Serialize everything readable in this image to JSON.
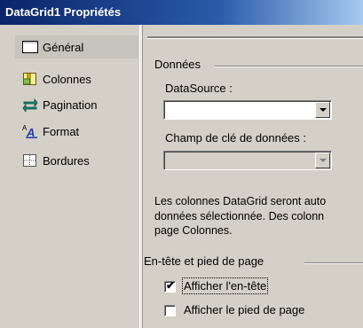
{
  "window": {
    "title": "DataGrid1 Propriétés"
  },
  "nav": {
    "items": [
      {
        "label": "Général",
        "icon": "general-page-icon",
        "selected": true
      },
      {
        "label": "Colonnes",
        "icon": "columns-icon"
      },
      {
        "label": "Pagination",
        "icon": "pagination-icon"
      },
      {
        "label": "Format",
        "icon": "format-icon"
      },
      {
        "label": "Bordures",
        "icon": "borders-icon"
      }
    ]
  },
  "data_group": {
    "title": "Données",
    "datasource_label": "DataSource :",
    "datasource_value": "",
    "keyfield_label": "Champ de clé de données :",
    "keyfield_value": "",
    "description": [
      "Les colonnes DataGrid seront auto",
      "données sélectionnée. Des colonn",
      "page Colonnes."
    ]
  },
  "header_footer_group": {
    "title": "En-tête et pied de page",
    "show_header_label": "Afficher l'en-tête",
    "show_header_checked": true,
    "show_footer_label": "Afficher le pied de page",
    "show_footer_checked": false
  }
}
